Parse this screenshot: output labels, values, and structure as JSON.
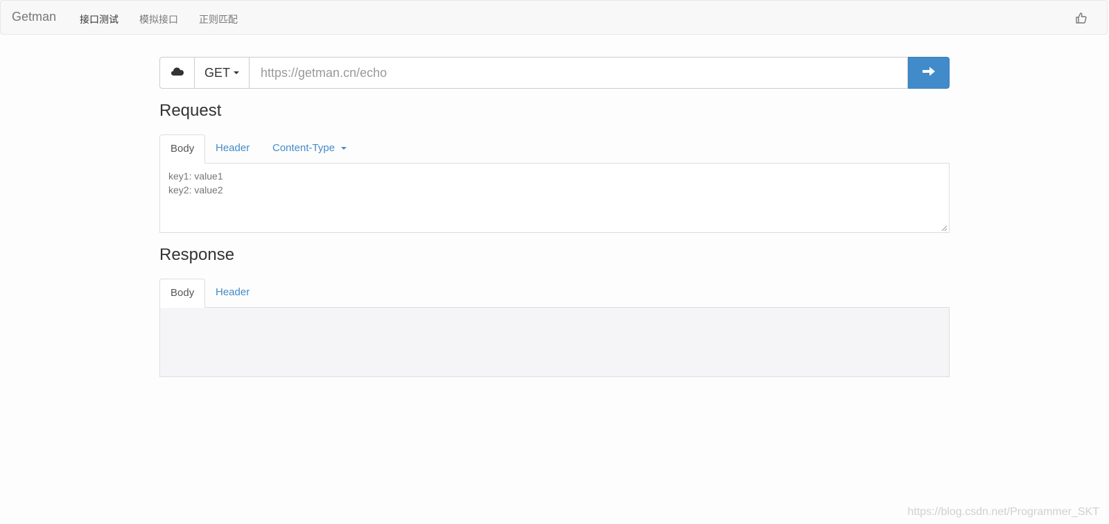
{
  "navbar": {
    "brand": "Getman",
    "items": [
      {
        "label": "接口测试",
        "active": true
      },
      {
        "label": "模拟接口",
        "active": false
      },
      {
        "label": "正则匹配",
        "active": false
      }
    ],
    "like_icon": "thumbs-up-icon"
  },
  "request_bar": {
    "cloud_icon": "cloud-icon",
    "method": "GET",
    "url_placeholder": "https://getman.cn/echo",
    "url_value": "",
    "send_icon": "arrow-right-icon",
    "send_color": "#428bca"
  },
  "request": {
    "title": "Request",
    "tabs": [
      "Body",
      "Header",
      "Content-Type"
    ],
    "active_tab": "Body",
    "body_placeholder": "key1: value1\nkey2: value2"
  },
  "response": {
    "title": "Response",
    "tabs": [
      "Body",
      "Header"
    ],
    "active_tab": "Body",
    "body": ""
  },
  "watermark": "https://blog.csdn.net/Programmer_SKT"
}
